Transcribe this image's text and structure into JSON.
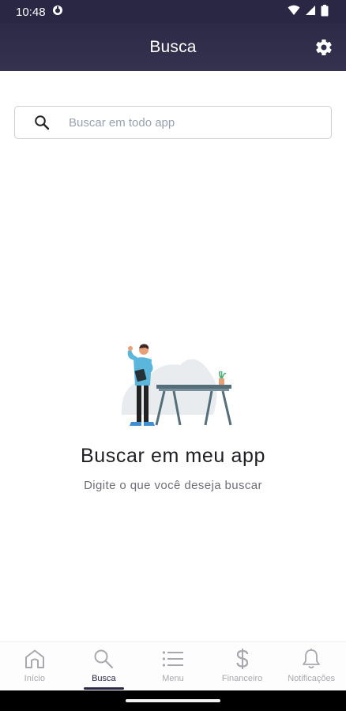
{
  "status_bar": {
    "time": "10:48"
  },
  "header": {
    "title": "Busca"
  },
  "search": {
    "placeholder": "Buscar em todo app",
    "value": ""
  },
  "empty_state": {
    "title": "Buscar em meu app",
    "subtitle": "Digite o que você deseja buscar"
  },
  "bottom_nav": {
    "items": [
      {
        "label": "Início",
        "icon": "home-icon"
      },
      {
        "label": "Busca",
        "icon": "search-icon",
        "active": true
      },
      {
        "label": "Menu",
        "icon": "menu-icon"
      },
      {
        "label": "Financeiro",
        "icon": "dollar-icon"
      },
      {
        "label": "Notificações",
        "icon": "bell-icon"
      }
    ]
  },
  "colors": {
    "header_bg": "#2a2745",
    "active_nav": "#2a2745",
    "inactive_nav": "#a8a8b0",
    "illustration_accent": "#5bb6dc"
  }
}
